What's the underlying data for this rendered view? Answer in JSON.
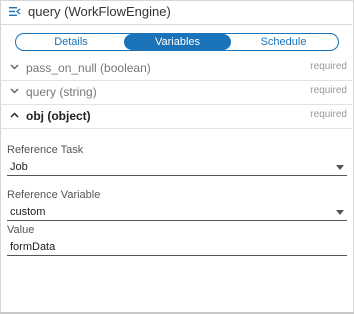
{
  "header": {
    "title": "query (WorkFlowEngine)",
    "icon": "list-icon"
  },
  "tabs": [
    {
      "label": "Details",
      "active": false
    },
    {
      "label": "Variables",
      "active": true
    },
    {
      "label": "Schedule",
      "active": false
    }
  ],
  "variables": [
    {
      "name": "pass_on_null (boolean)",
      "status": "required",
      "expanded": false
    },
    {
      "name": "query (string)",
      "status": "required",
      "expanded": false
    },
    {
      "name": "obj (object)",
      "status": "required",
      "expanded": true
    }
  ],
  "form": {
    "reference_task_label": "Reference Task",
    "reference_task_value": "Job",
    "reference_variable_label": "Reference Variable",
    "reference_variable_value": "custom",
    "value_label": "Value",
    "value_value": "formData"
  },
  "colors": {
    "accent": "#1a73b8"
  }
}
